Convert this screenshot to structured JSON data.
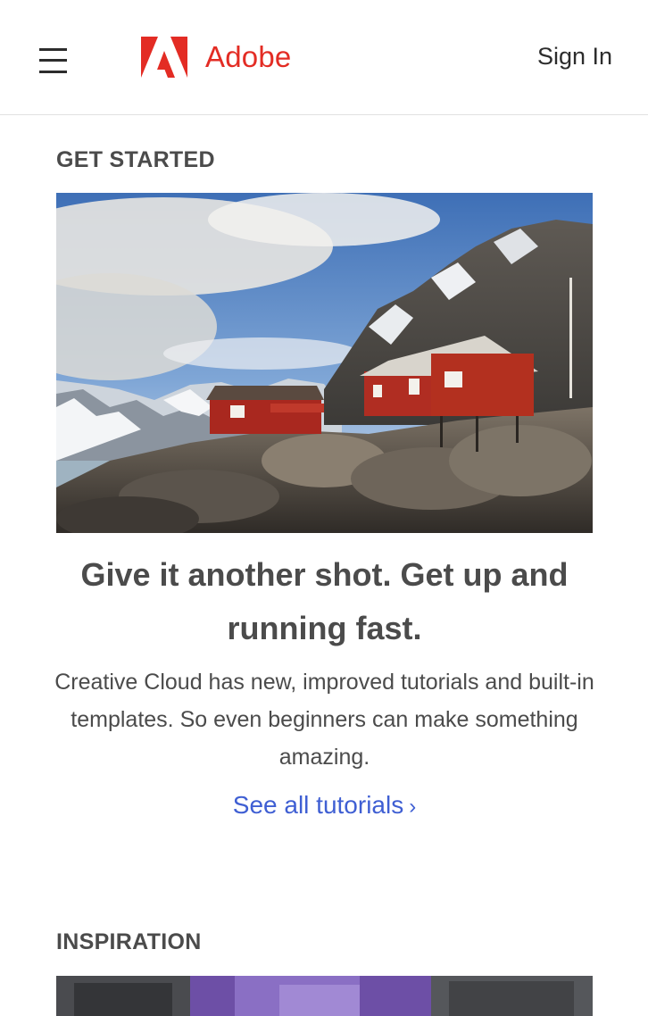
{
  "header": {
    "brand_name": "Adobe",
    "brand_color": "#e32c24",
    "menu_icon": "hamburger-menu-icon",
    "sign_in_label": "Sign In"
  },
  "get_started": {
    "heading": "GET STARTED",
    "image_subject": "red cabins on rocky shore with snowy mountains",
    "title": "Give it another shot. Get up and running fast.",
    "description": "Creative Cloud has new, improved tutorials and built-in templates. So even beginners can make something amazing.",
    "link_label": "See all tutorials",
    "link_chevron": "›",
    "link_color": "#3f5fd3"
  },
  "inspiration": {
    "heading": "INSPIRATION",
    "image_subject": "printed pattern blocks in grey and purple"
  }
}
